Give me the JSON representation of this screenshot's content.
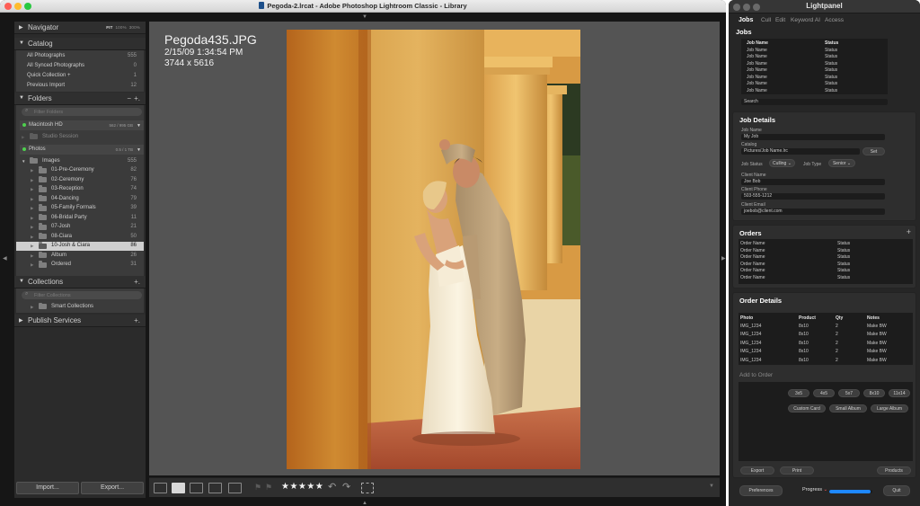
{
  "lightroom": {
    "title": "Pegoda-2.lrcat - Adobe Photoshop Lightroom Classic - Library",
    "navigator": {
      "title": "Navigator",
      "zooms": [
        "FIT",
        "100%",
        "300%"
      ],
      "zoom_active": "FIT"
    },
    "catalog": {
      "title": "Catalog",
      "items": [
        {
          "label": "All Photographs",
          "count": "555"
        },
        {
          "label": "All Synced Photographs",
          "count": "0"
        },
        {
          "label": "Quick Collection +",
          "count": "1"
        },
        {
          "label": "Previous Import",
          "count": "12"
        }
      ]
    },
    "folders": {
      "title": "Folders",
      "filter_placeholder": "Filter Folders",
      "volume1": {
        "name": "Macintosh HD",
        "capacity": "562 / 995 GB"
      },
      "studio_session": "Studio Session",
      "volume2": {
        "name": "Photos",
        "capacity": "0.5 / 1 TB"
      },
      "root": {
        "label": "Images",
        "count": "555"
      },
      "items": [
        {
          "label": "01-Pre-Ceremony",
          "count": "82"
        },
        {
          "label": "02-Ceremony",
          "count": "76"
        },
        {
          "label": "03-Reception",
          "count": "74"
        },
        {
          "label": "04-Dancing",
          "count": "79"
        },
        {
          "label": "05-Family Formals",
          "count": "39"
        },
        {
          "label": "06-Bridal Party",
          "count": "11"
        },
        {
          "label": "07-Josh",
          "count": "21"
        },
        {
          "label": "08-Ciara",
          "count": "50"
        },
        {
          "label": "10-Josh & Ciara",
          "count": "86"
        },
        {
          "label": "Album",
          "count": "26"
        },
        {
          "label": "Ordered",
          "count": "31"
        }
      ],
      "selected_index": 8
    },
    "collections": {
      "title": "Collections",
      "filter_placeholder": "Filter Collections",
      "smart": "Smart Collections"
    },
    "publish": {
      "title": "Publish Services"
    },
    "import_label": "Import...",
    "export_label": "Export...",
    "photo_info": {
      "filename": "Pegoda435.JPG",
      "datetime": "2/15/09 1:34:54 PM",
      "dimensions": "3744 x 5616"
    },
    "toolbar": {
      "rating": "★★★★★",
      "rating_value": 5
    }
  },
  "lightpanel": {
    "title": "Lightpanel",
    "tabs": [
      "Jobs",
      "Cull",
      "Edit",
      "Keyword AI",
      "Access"
    ],
    "active_tab": "Jobs",
    "jobs": {
      "heading": "Jobs",
      "col_name": "Job Name",
      "col_status": "Status",
      "rows": [
        {
          "name": "Job Name",
          "status": "Status"
        },
        {
          "name": "Job Name",
          "status": "Status"
        },
        {
          "name": "Job Name",
          "status": "Status"
        },
        {
          "name": "Job Name",
          "status": "Status"
        },
        {
          "name": "Job Name",
          "status": "Status"
        },
        {
          "name": "Job Name",
          "status": "Status"
        },
        {
          "name": "Job Name",
          "status": "Status"
        }
      ],
      "search_placeholder": "Search"
    },
    "job_details": {
      "heading": "Job Details",
      "job_name_label": "Job Name",
      "job_name_value": "My Job",
      "catalog_label": "Catalog",
      "catalog_value": "Pictures/Job Name.lrc",
      "set_label": "Set",
      "job_status_label": "Job Status",
      "job_status_value": "Culling",
      "job_type_label": "Job Type",
      "job_type_value": "Senior",
      "client_name_label": "Client Name",
      "client_name_value": "Joe Bob",
      "client_phone_label": "Client Phone",
      "client_phone_value": "503-555-1212",
      "client_email_label": "Client Email",
      "client_email_value": "joebob@client.com"
    },
    "orders": {
      "heading": "Orders",
      "col_name": "Order Name",
      "col_status": "Status",
      "rows": [
        {
          "name": "Order Name",
          "status": "Status"
        },
        {
          "name": "Order Name",
          "status": "Status"
        },
        {
          "name": "Order Name",
          "status": "Status"
        },
        {
          "name": "Order Name",
          "status": "Status"
        },
        {
          "name": "Order Name",
          "status": "Status"
        },
        {
          "name": "Order Name",
          "status": "Status"
        }
      ]
    },
    "order_details": {
      "heading": "Order Details",
      "cols": [
        "Photo",
        "Product",
        "Qty",
        "Notes"
      ],
      "rows": [
        [
          "IMG_1234",
          "8x10",
          "2",
          "Make BW"
        ],
        [
          "IMG_1234",
          "8x10",
          "2",
          "Make BW"
        ],
        [
          "IMG_1234",
          "8x10",
          "2",
          "Make BW"
        ],
        [
          "IMG_1234",
          "8x10",
          "2",
          "Make BW"
        ],
        [
          "IMG_1234",
          "8x10",
          "2",
          "Make BW"
        ]
      ],
      "add_to_order": "Add to Order",
      "sizes": [
        "3x5",
        "4x5",
        "5x7",
        "8x10",
        "11x14"
      ],
      "products": [
        "Custom Card",
        "Small Album",
        "Large Album"
      ],
      "export_label": "Export",
      "print_label": "Print",
      "products_label": "Products"
    },
    "footer": {
      "preferences_label": "Preferences",
      "progress_label": "Progress",
      "progress_value": 0.95,
      "quit_label": "Quit"
    }
  }
}
